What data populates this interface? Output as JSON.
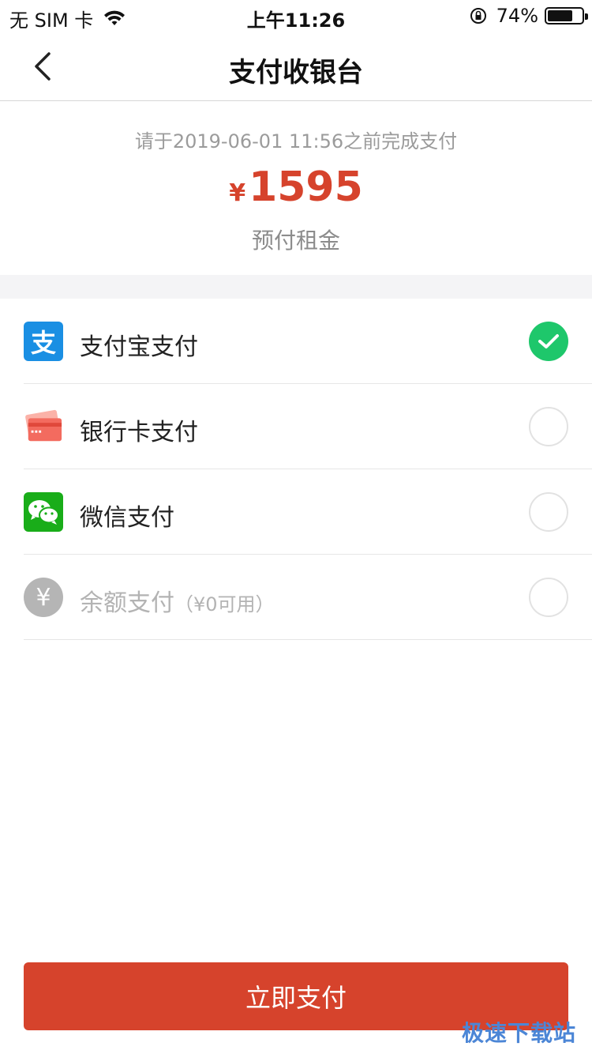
{
  "status_bar": {
    "carrier": "无 SIM 卡",
    "time": "上午11:26",
    "battery_percent": "74%",
    "battery_level": 0.74
  },
  "nav": {
    "title": "支付收银台",
    "back_icon": "chevron-left-icon"
  },
  "order": {
    "deadline_text": "请于2019-06-01 11:56之前完成支付",
    "currency_symbol": "¥",
    "amount": "1595",
    "amount_label": "预付租金"
  },
  "payment_methods": [
    {
      "label": "支付宝支付",
      "sub": "",
      "icon": "alipay-icon",
      "icon_glyph": "支",
      "selected": true,
      "enabled": true
    },
    {
      "label": "银行卡支付",
      "sub": "",
      "icon": "bank-card-icon",
      "selected": false,
      "enabled": true
    },
    {
      "label": "微信支付",
      "sub": "",
      "icon": "wechat-icon",
      "selected": false,
      "enabled": true
    },
    {
      "label": "余额支付",
      "sub": "（¥0可用）",
      "icon": "balance-icon",
      "icon_glyph": "¥",
      "selected": false,
      "enabled": false
    }
  ],
  "pay_button": {
    "label": "立即支付"
  },
  "watermark": "极速下载站",
  "colors": {
    "accent_red": "#d6432c",
    "check_green": "#1ec76b",
    "alipay_blue": "#1a8fe3",
    "bank_card_pink": "#f36b5f",
    "wechat_green": "#19ad19",
    "balance_gray": "#b5b5b5"
  }
}
